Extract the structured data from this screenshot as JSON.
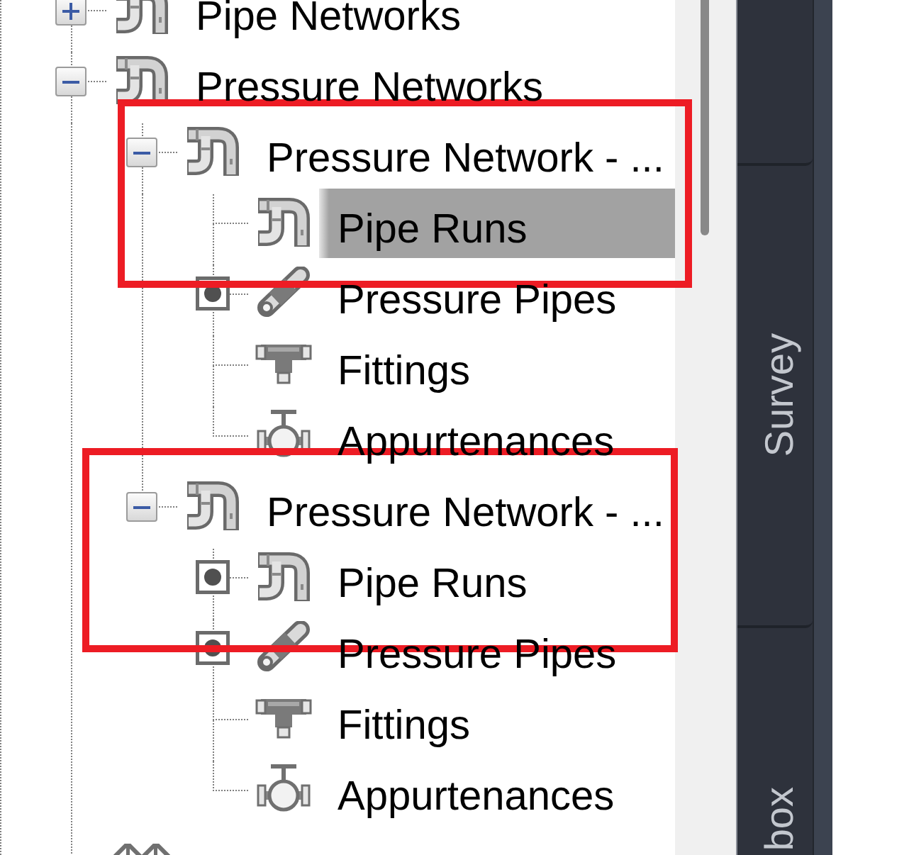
{
  "tree": {
    "items": [
      {
        "label": "Pipe Networks",
        "kind": "pipe-network",
        "selected": false,
        "expanded": false
      },
      {
        "label": "Pressure Networks",
        "kind": "pipe-network",
        "selected": false,
        "expanded": true,
        "children": [
          {
            "label": "Pressure Network - ...",
            "kind": "pipe-network",
            "selected": false,
            "expanded": true,
            "children": [
              {
                "label": "Pipe Runs",
                "kind": "pipe-network",
                "selected": true,
                "has_objects": false
              },
              {
                "label": "Pressure Pipes",
                "kind": "pressure-pipe",
                "selected": false,
                "has_objects": true
              },
              {
                "label": "Fittings",
                "kind": "fitting",
                "selected": false,
                "has_objects": false
              },
              {
                "label": "Appurtenances",
                "kind": "appurtenance",
                "selected": false,
                "has_objects": false
              }
            ]
          },
          {
            "label": "Pressure Network - ...",
            "kind": "pipe-network",
            "selected": false,
            "expanded": true,
            "children": [
              {
                "label": "Pipe Runs",
                "kind": "pipe-network",
                "selected": false,
                "has_objects": true
              },
              {
                "label": "Pressure Pipes",
                "kind": "pressure-pipe",
                "selected": false,
                "has_objects": true
              },
              {
                "label": "Fittings",
                "kind": "fitting",
                "selected": false,
                "has_objects": false
              },
              {
                "label": "Appurtenances",
                "kind": "appurtenance",
                "selected": false,
                "has_objects": false
              }
            ]
          }
        ]
      },
      {
        "kind": "bridge",
        "selected": false
      }
    ]
  },
  "annotation_frames": [
    {
      "kind": "rectangle"
    },
    {
      "kind": "rectangle"
    }
  ],
  "toolspace_tabs": [
    {
      "selected": false
    },
    {
      "label": "Survey",
      "selected": false
    },
    {
      "label": "box",
      "selected": false
    }
  ]
}
